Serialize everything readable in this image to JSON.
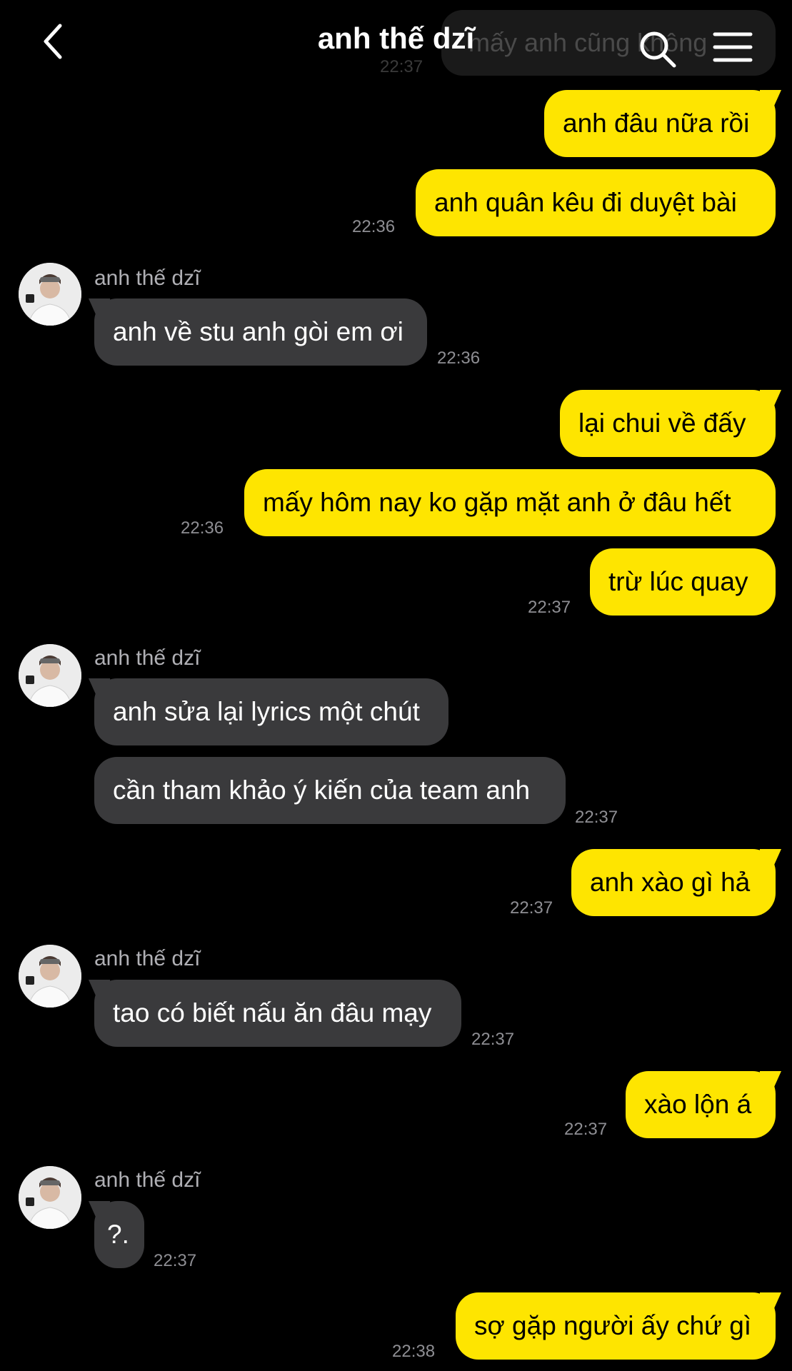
{
  "header": {
    "title": "anh thế dzĩ",
    "faded_message": "mấy anh cũng không",
    "faded_time": "22:37"
  },
  "messages": [
    {
      "text": "anh đâu nữa rồi"
    },
    {
      "text": "anh quân kêu đi duyệt bài",
      "time": "22:36"
    },
    {
      "sender": "anh thế dzĩ",
      "text": "anh về stu anh gòi em ơi",
      "time": "22:36"
    },
    {
      "text": "lại chui về đấy"
    },
    {
      "text": "mấy hôm nay ko gặp mặt anh ở đâu hết",
      "time": "22:36"
    },
    {
      "text": "trừ lúc quay",
      "time": "22:37"
    },
    {
      "sender": "anh thế dzĩ",
      "text": "anh sửa lại lyrics một chút"
    },
    {
      "text": "cần tham khảo ý kiến của team anh",
      "time": "22:37"
    },
    {
      "text": "anh xào gì hả",
      "time": "22:37"
    },
    {
      "sender": "anh thế dzĩ",
      "text": "tao có biết nấu ăn đâu mạy",
      "time": "22:37"
    },
    {
      "text": "xào lộn á",
      "time": "22:37"
    },
    {
      "sender": "anh thế dzĩ",
      "text": "?.",
      "time": "22:37"
    },
    {
      "text": "sợ gặp người ấy chứ gì",
      "time": "22:38"
    }
  ],
  "colors": {
    "outgoing": "#FEE500",
    "incoming": "#3A3A3C",
    "background": "#000000"
  },
  "icons": [
    "back-chevron-icon",
    "search-icon",
    "menu-icon"
  ]
}
